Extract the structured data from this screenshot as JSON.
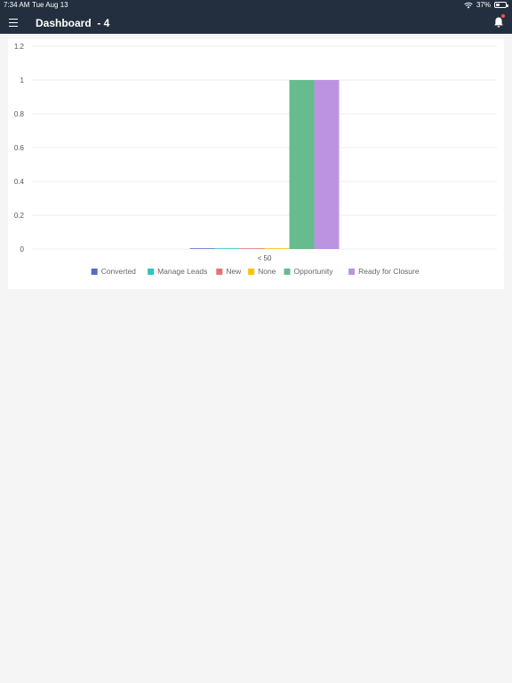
{
  "status_bar": {
    "time": "7:34 AM",
    "date": "Tue Aug 13",
    "battery": "37%",
    "battery_level": 0.37
  },
  "header": {
    "title": "Dashboard  - 4",
    "menu_icon": "hamburger-icon",
    "bell_icon": "bell-icon",
    "accent": "#232f3e"
  },
  "chart_data": {
    "type": "bar",
    "categories": [
      "< 50"
    ],
    "series": [
      {
        "name": "Converted",
        "color": "#5b6bc0",
        "values": [
          0
        ]
      },
      {
        "name": "Manage Leads",
        "color": "#2ec4c0",
        "values": [
          0
        ]
      },
      {
        "name": "New",
        "color": "#e57373",
        "values": [
          0
        ]
      },
      {
        "name": "None",
        "color": "#ffc107",
        "values": [
          0
        ]
      },
      {
        "name": "Opportunity",
        "color": "#66bb8f",
        "values": [
          1
        ]
      },
      {
        "name": "Ready for Closure",
        "color": "#bb93e0",
        "values": [
          1
        ]
      }
    ],
    "yticks": [
      "0",
      "0.2",
      "0.4",
      "0.6",
      "0.8",
      "1",
      "1.2"
    ],
    "ylim": [
      0,
      1.2
    ],
    "grid": true,
    "legend": "bottom"
  }
}
